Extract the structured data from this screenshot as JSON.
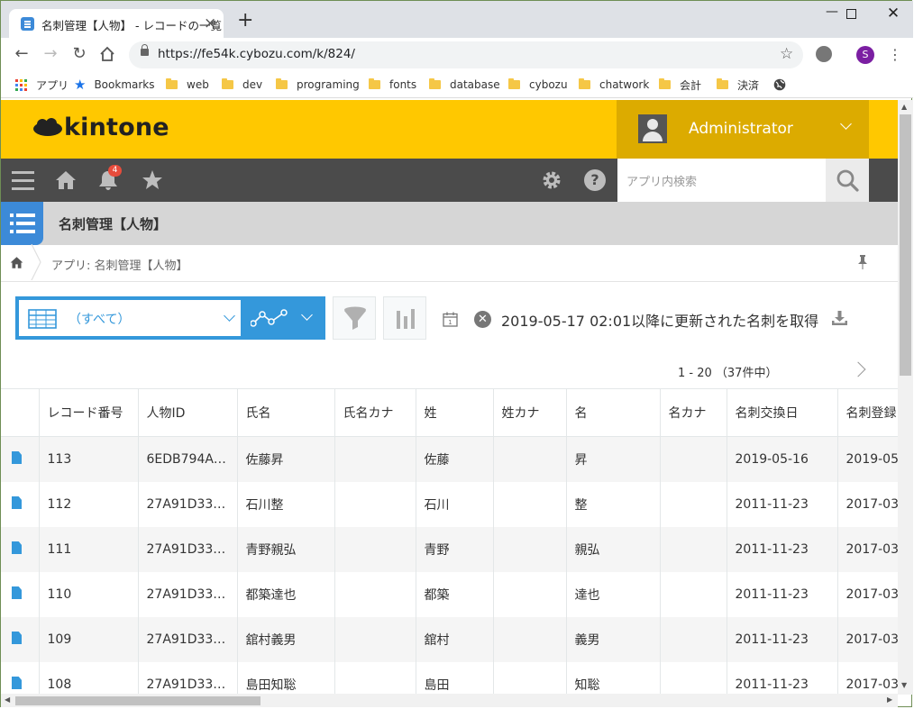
{
  "browser": {
    "tab_title": "名刺管理【人物】 - レコードの一覧",
    "url": "https://fe54k.cybozu.com/k/824/",
    "profile_initial": "S",
    "bookmarks": [
      {
        "label": "アプリ",
        "icon": "apps-grid-icon"
      },
      {
        "label": "Bookmarks",
        "icon": "star-icon"
      },
      {
        "label": "web",
        "icon": "folder-icon"
      },
      {
        "label": "dev",
        "icon": "folder-icon"
      },
      {
        "label": "programing",
        "icon": "folder-icon"
      },
      {
        "label": "fonts",
        "icon": "folder-icon"
      },
      {
        "label": "database",
        "icon": "folder-icon"
      },
      {
        "label": "cybozu",
        "icon": "folder-icon"
      },
      {
        "label": "chatwork",
        "icon": "folder-icon"
      },
      {
        "label": "会計",
        "icon": "folder-icon"
      },
      {
        "label": "決済",
        "icon": "folder-icon"
      }
    ]
  },
  "header": {
    "logo": "kintone",
    "user_name": "Administrator",
    "notification_count": "4",
    "search_placeholder": "アプリ内検索",
    "accent_color": "#ffc800"
  },
  "app": {
    "title": "名刺管理【人物】",
    "breadcrumb": "アプリ: 名刺管理【人物】"
  },
  "toolbar": {
    "view_label": "（すべて）",
    "update_notice": "2019-05-17 02:01以降に更新された名刺を取得",
    "pager": "1 - 20 （37件中）"
  },
  "table": {
    "columns": [
      "レコード番号",
      "人物ID",
      "氏名",
      "氏名カナ",
      "姓",
      "姓カナ",
      "名",
      "名カナ",
      "名刺交換日",
      "名刺登録"
    ],
    "rows": [
      [
        "113",
        "6EDB794A…",
        "佐藤昇",
        "",
        "佐藤",
        "",
        "昇",
        "",
        "2019-05-16",
        "2019-05"
      ],
      [
        "112",
        "27A91D33…",
        "石川整",
        "",
        "石川",
        "",
        "整",
        "",
        "2011-11-23",
        "2017-03"
      ],
      [
        "111",
        "27A91D33…",
        "青野親弘",
        "",
        "青野",
        "",
        "親弘",
        "",
        "2011-11-23",
        "2017-03"
      ],
      [
        "110",
        "27A91D33…",
        "都築達也",
        "",
        "都築",
        "",
        "達也",
        "",
        "2011-11-23",
        "2017-03"
      ],
      [
        "109",
        "27A91D33…",
        "舘村義男",
        "",
        "舘村",
        "",
        "義男",
        "",
        "2011-11-23",
        "2017-03"
      ],
      [
        "108",
        "27A91D33…",
        "島田知聡",
        "",
        "島田",
        "",
        "知聡",
        "",
        "2011-11-23",
        "2017-03"
      ]
    ]
  }
}
